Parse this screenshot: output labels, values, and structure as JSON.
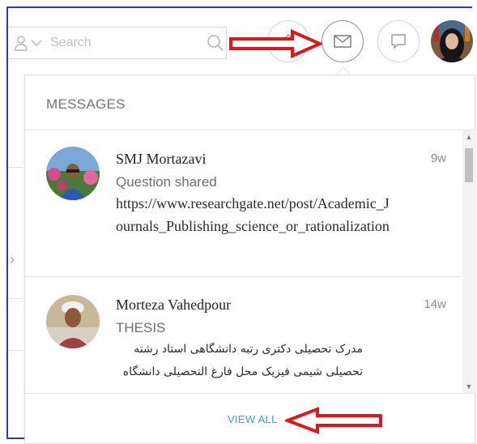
{
  "header": {
    "search": {
      "placeholder": "Search"
    },
    "buttons": [
      {
        "name": "bookmark-button",
        "icon": "diamond-icon"
      },
      {
        "name": "messages-button",
        "icon": "envelope-icon"
      },
      {
        "name": "notifications-button",
        "icon": "speech-bubble-icon"
      }
    ]
  },
  "messages": {
    "title": "MESSAGES",
    "items": [
      {
        "sender": "SMJ Mortazavi",
        "time": "9w",
        "subtitle": "Question shared",
        "body": "https://www.researchgate.net/post/Academic_Journals_Publishing_science_or_rationalization"
      },
      {
        "sender": "Morteza Vahedpour",
        "time": "14w",
        "subtitle": "THESIS",
        "body": "مدرک تحصیلی دکتری رتبه دانشگاهی استاد رشته تحصیلی شیمی فیزیک محل فارغ التحصیلی دانشگاه"
      }
    ],
    "view_all_label": "VIEW ALL"
  },
  "colors": {
    "annotation_arrow": "#e0161b",
    "frame": "#2a36c8",
    "view_all": "#3aa8a8"
  }
}
